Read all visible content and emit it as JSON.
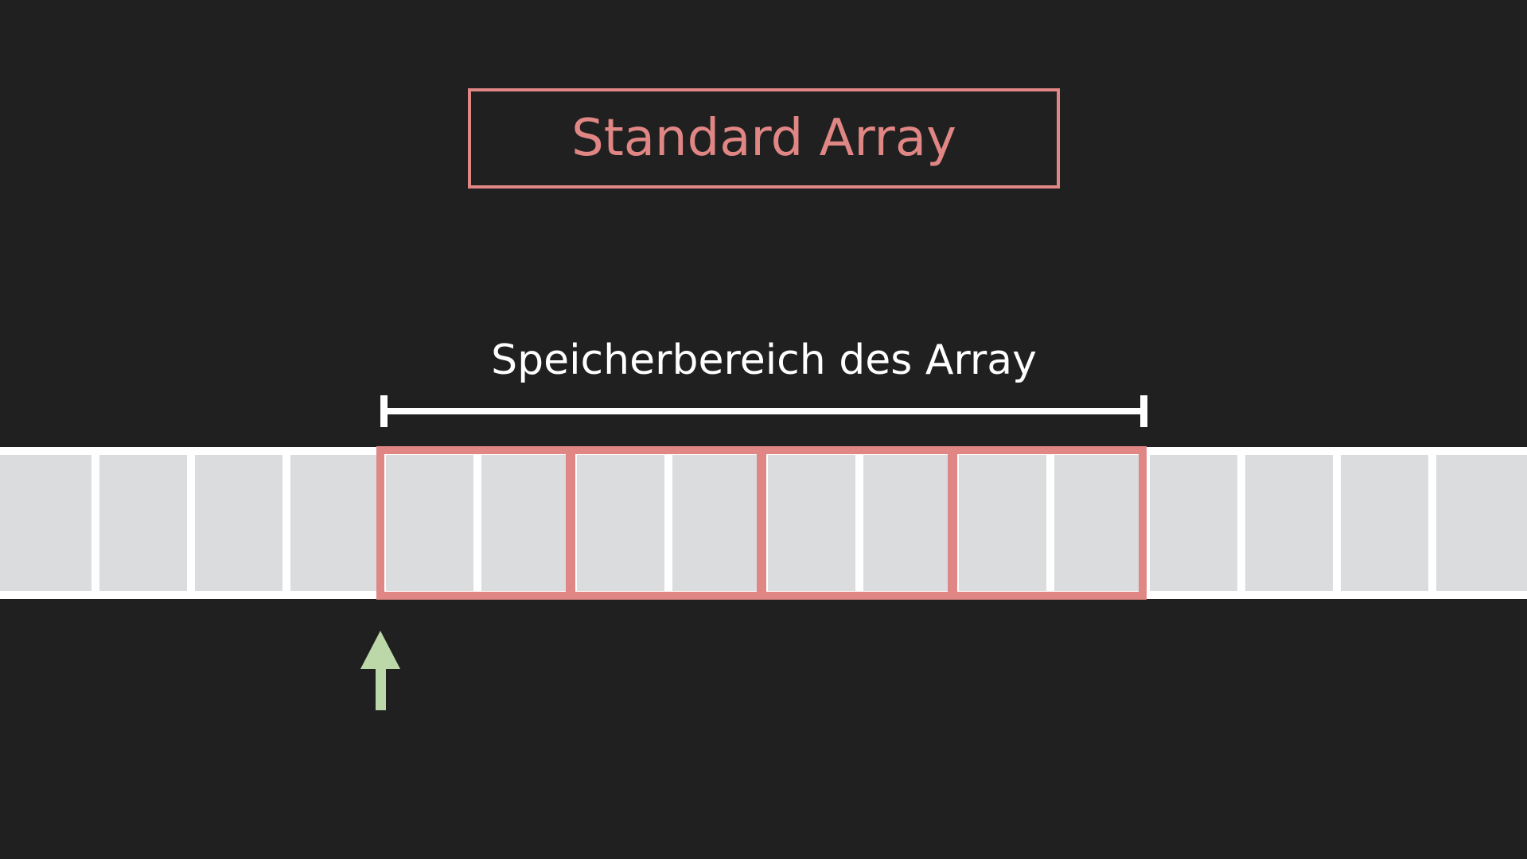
{
  "title": "Standard Array",
  "range_label": "Speicherbereich des Array",
  "memory": {
    "total_cells": 16,
    "array_start_cell": 4,
    "array_cells": 8,
    "array_elements": 4,
    "cells_per_element": 2
  },
  "pointer": {
    "target_cell": 4,
    "icon": "arrow-up-icon"
  },
  "colors": {
    "background": "#202020",
    "cell_fill": "#dbdcdd",
    "cell_border": "#ffffff",
    "array_accent": "#e08684",
    "label_text": "#ffffff",
    "pointer": "#bcd8a8"
  }
}
